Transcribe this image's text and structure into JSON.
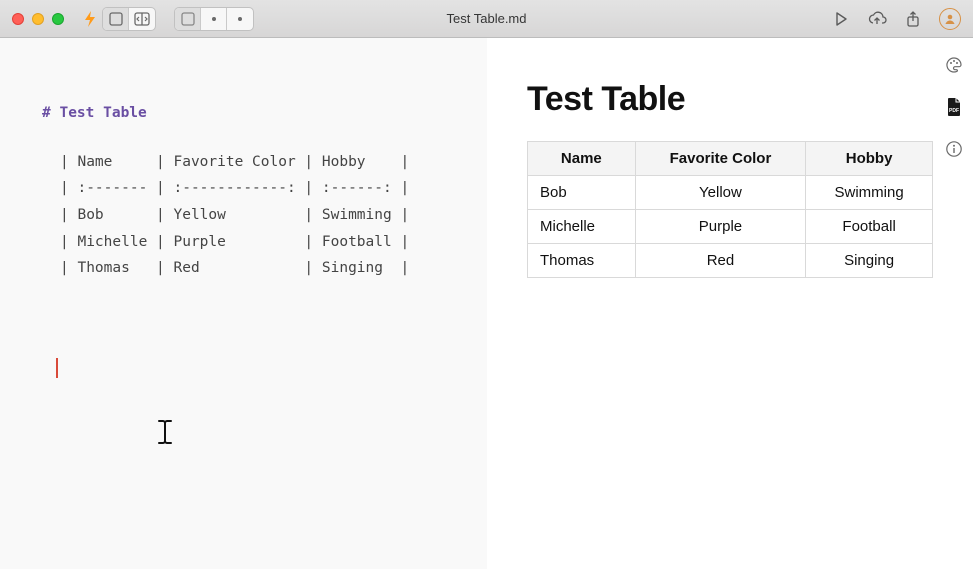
{
  "window": {
    "title": "Test Table.md"
  },
  "editor": {
    "heading": "# Test Table",
    "line1": "| Name     | Favorite Color | Hobby    |",
    "line2": "| :------- | :------------: | :------: |",
    "line3": "| Bob      | Yellow         | Swimming |",
    "line4": "| Michelle | Purple         | Football |",
    "line5": "| Thomas   | Red            | Singing  |"
  },
  "preview": {
    "title": "Test Table",
    "headers": {
      "name": "Name",
      "color": "Favorite Color",
      "hobby": "Hobby"
    },
    "rows": [
      {
        "name": "Bob",
        "color": "Yellow",
        "hobby": "Swimming"
      },
      {
        "name": "Michelle",
        "color": "Purple",
        "hobby": "Football"
      },
      {
        "name": "Thomas",
        "color": "Red",
        "hobby": "Singing"
      }
    ]
  },
  "chart_data": {
    "type": "table",
    "title": "Test Table",
    "columns": [
      "Name",
      "Favorite Color",
      "Hobby"
    ],
    "rows": [
      [
        "Bob",
        "Yellow",
        "Swimming"
      ],
      [
        "Michelle",
        "Purple",
        "Football"
      ],
      [
        "Thomas",
        "Red",
        "Singing"
      ]
    ]
  }
}
